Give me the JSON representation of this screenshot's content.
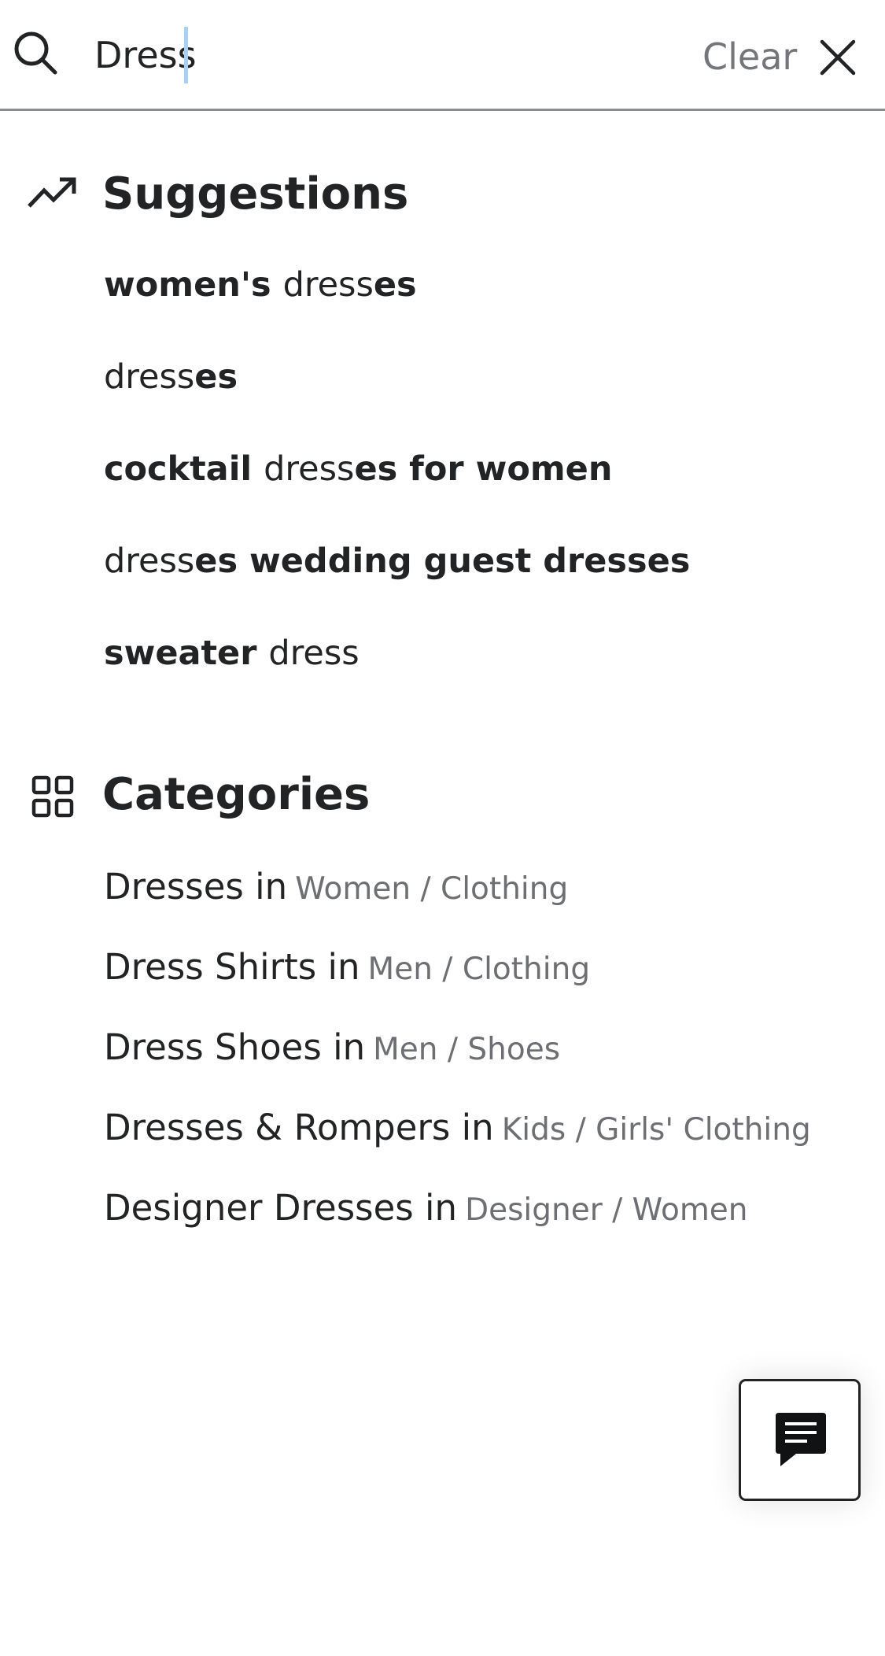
{
  "search": {
    "value": "Dress",
    "clear_label": "Clear"
  },
  "suggestions": {
    "heading": "Suggestions",
    "icon": "trending-up-icon",
    "items": [
      {
        "parts": [
          {
            "text": "women's ",
            "bold": true
          },
          {
            "text": "dress",
            "bold": false
          },
          {
            "text": "es",
            "bold": true
          }
        ]
      },
      {
        "parts": [
          {
            "text": "dress",
            "bold": false
          },
          {
            "text": "es",
            "bold": true
          }
        ]
      },
      {
        "parts": [
          {
            "text": "cocktail ",
            "bold": true
          },
          {
            "text": "dress",
            "bold": false
          },
          {
            "text": "es for women",
            "bold": true
          }
        ]
      },
      {
        "parts": [
          {
            "text": "dress",
            "bold": false
          },
          {
            "text": "es wedding guest dresses",
            "bold": true
          }
        ]
      },
      {
        "parts": [
          {
            "text": "sweater ",
            "bold": true
          },
          {
            "text": "dress",
            "bold": false
          }
        ]
      }
    ]
  },
  "categories": {
    "heading": "Categories",
    "icon": "grid-icon",
    "items": [
      {
        "name": "Dresses in",
        "path": "Women / Clothing"
      },
      {
        "name": "Dress Shirts in",
        "path": "Men / Clothing"
      },
      {
        "name": "Dress Shoes in",
        "path": "Men / Shoes"
      },
      {
        "name": "Dresses & Rompers in",
        "path": "Kids / Girls' Clothing"
      },
      {
        "name": "Designer Dresses in",
        "path": "Designer / Women"
      }
    ]
  },
  "chat": {
    "icon": "chat-icon"
  }
}
